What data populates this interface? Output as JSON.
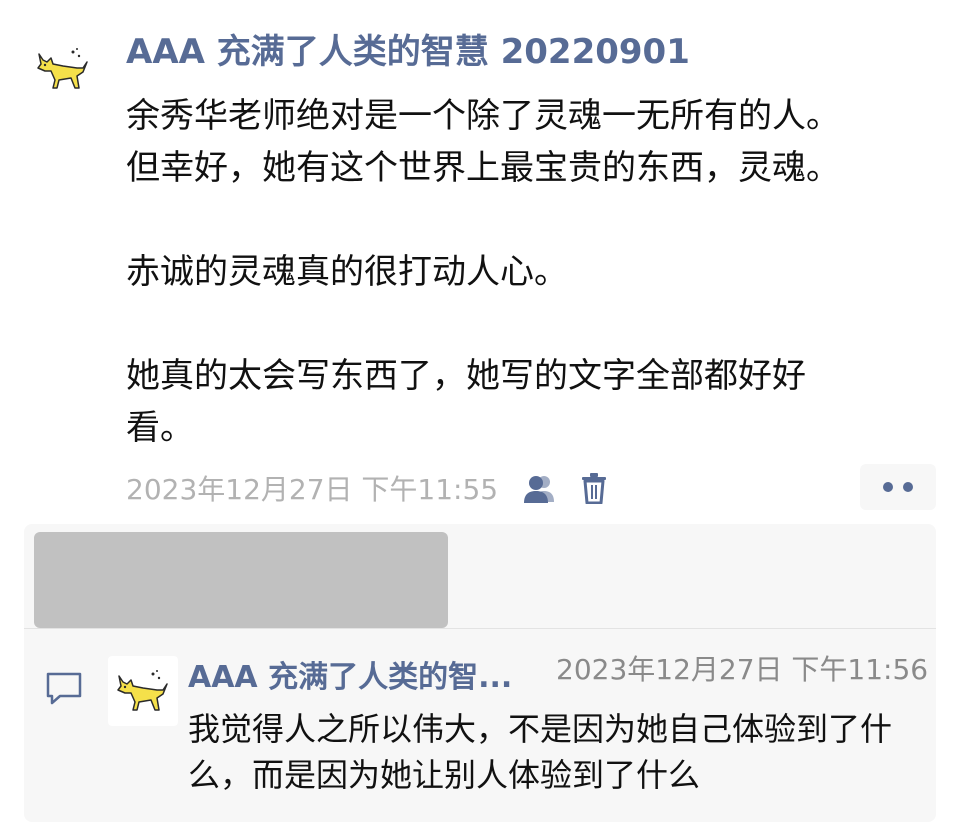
{
  "post": {
    "author": "AAA 充满了人类的智慧 20220901",
    "avatar_icon": "yellow-cat-icon",
    "lines": [
      "余秀华老师绝对是一个除了灵魂一无所有的人。",
      "但幸好，她有这个世界上最宝贵的东西，灵魂。",
      "",
      "赤诚的灵魂真的很打动人心。",
      "",
      "她真的太会写东西了，她写的文字全部都好好",
      "看。"
    ],
    "time": "2023年12月27日 下午11:55",
    "visibility_icon": "friends-visibility-icon",
    "delete_icon": "trash-icon",
    "more_icon": "more-dots-icon"
  },
  "interactions": {
    "comment_icon": "comment-bubble-icon",
    "comments": [
      {
        "author": "AAA 充满了人类的智...",
        "avatar_icon": "yellow-cat-icon",
        "time": "2023年12月27日 下午11:56",
        "text": "我觉得人之所以伟大，不是因为她自己体验到了什么，而是因为她让别人体验到了什么"
      }
    ]
  },
  "colors": {
    "link": "#576b95",
    "muted": "#b2b2b2",
    "panel_bg": "#f7f7f7",
    "redaction": "#c1c1c1",
    "cat_yellow": "#f5e04a"
  }
}
